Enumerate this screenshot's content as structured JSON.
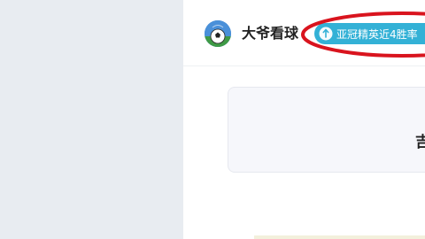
{
  "author": {
    "name": "大爷看球",
    "avatar_icon": "soccer-ball-icon"
  },
  "tag": {
    "label": "亚冠精英近4胜率",
    "icon": "arrow-up-icon",
    "color": "#33b1d6"
  },
  "annotation": {
    "color": "#d9141e"
  },
  "card": {
    "visible_text": "吉"
  }
}
